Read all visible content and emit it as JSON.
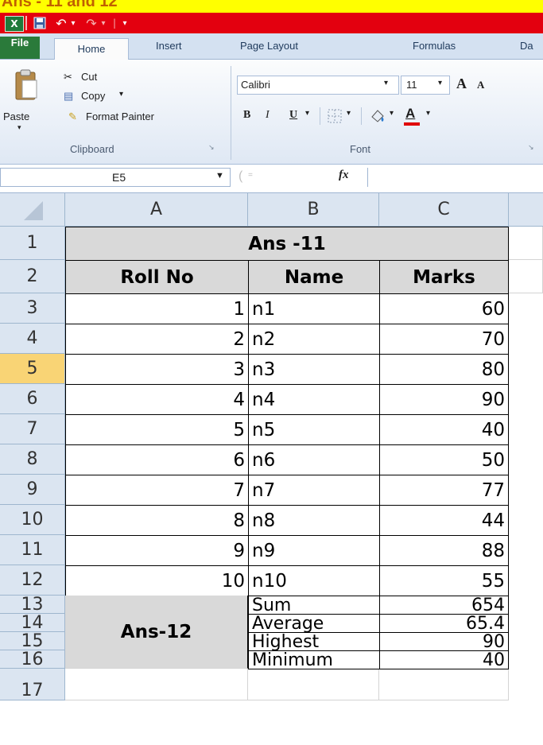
{
  "top_text": "Ans - 11 and 12",
  "qat": {
    "undo": "↶",
    "redo": "↷",
    "separator": "|",
    "customize": "▾"
  },
  "tabs": [
    "File",
    "Home",
    "Insert",
    "Page Layout",
    "Formulas",
    "Da"
  ],
  "clipboard": {
    "paste": "Paste",
    "cut": "Cut",
    "copy": "Copy",
    "format_painter": "Format Painter",
    "group_label": "Clipboard"
  },
  "font": {
    "name": "Calibri",
    "size": "11",
    "bold": "B",
    "italic": "I",
    "underline": "U",
    "group_label": "Font",
    "grow": "A",
    "shrink": "A",
    "font_color": "A"
  },
  "formula_bar": {
    "name_box": "E5",
    "fx": "fx",
    "value": ""
  },
  "columns": [
    "A",
    "B",
    "C"
  ],
  "rows": [
    "1",
    "2",
    "3",
    "4",
    "5",
    "6",
    "7",
    "8",
    "9",
    "10",
    "11",
    "12",
    "13",
    "14",
    "15",
    "16",
    "17"
  ],
  "selected_row": "5",
  "sheet": {
    "title": "Ans -11",
    "headers": [
      "Roll No",
      "Name",
      "Marks"
    ],
    "records": [
      [
        "1",
        "n1",
        "60"
      ],
      [
        "2",
        "n2",
        "70"
      ],
      [
        "3",
        "n3",
        "80"
      ],
      [
        "4",
        "n4",
        "90"
      ],
      [
        "5",
        "n5",
        "40"
      ],
      [
        "6",
        "n6",
        "50"
      ],
      [
        "7",
        "n7",
        "77"
      ],
      [
        "8",
        "n8",
        "44"
      ],
      [
        "9",
        "n9",
        "88"
      ],
      [
        "10",
        "n10",
        "55"
      ]
    ],
    "summary_label": "Ans-12",
    "summary": [
      [
        "Sum",
        "654"
      ],
      [
        "Average",
        "65.4"
      ],
      [
        "Highest",
        "90"
      ],
      [
        "Minimum",
        "40"
      ]
    ]
  }
}
